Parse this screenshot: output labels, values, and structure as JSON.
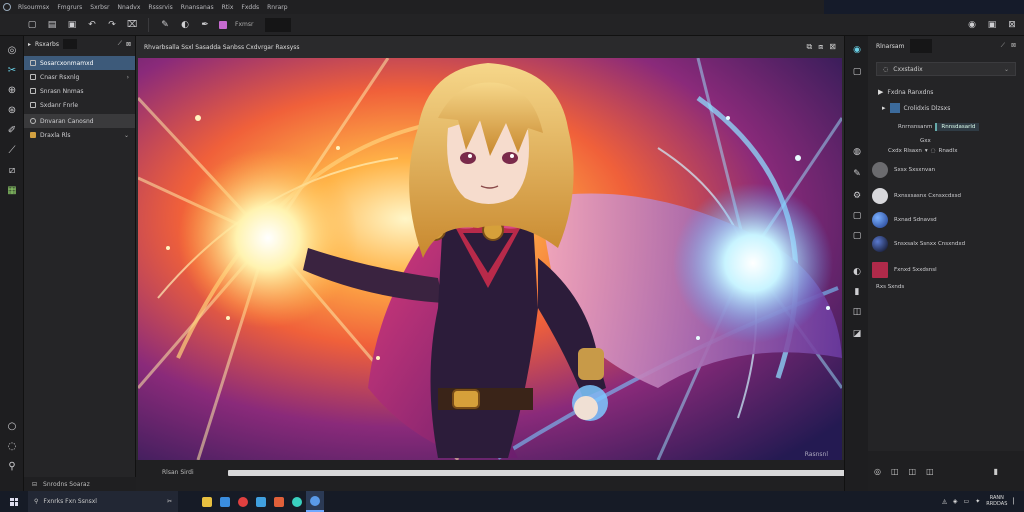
{
  "menubar": {
    "items": [
      "Rlsourmsx",
      "Fmgrurs",
      "Sxrbsr",
      "Nnadvx",
      "Rsssrvis",
      "Rnansanas",
      "Rtix",
      "Fxdds",
      "Rnrarp"
    ]
  },
  "toolbar": {
    "document_tab": "Fxmsr"
  },
  "layers": {
    "title": "Rsxarbs",
    "items": [
      {
        "label": "Sosarcxonmamxd"
      },
      {
        "label": "Cnasr Rsxnlg"
      },
      {
        "label": "Snrasn Nnmas"
      },
      {
        "label": "Sxdanr Fnrle"
      },
      {
        "label": "Dnvaran Canosnd"
      },
      {
        "label": "Draxla Rls"
      }
    ],
    "footer": "Snrodns Soaraz"
  },
  "document": {
    "title": "Rhvarbsalla Ssxl Sasadda Sanbss Cxdvrgar Raxsyss",
    "footer_tab": "Rlsan Sirdi",
    "watermark": "Rasnsnl"
  },
  "properties": {
    "title": "Rlnarsam",
    "select_value": "Cxxstadix",
    "tree_root": "Fxdna Ranxdns",
    "tree_child": "Crolidxis Dlzsxs",
    "prop1_label": "Rnrnsnsanm",
    "prop1_value": "Rnnsdasarld",
    "prop2_label": "Cxdx Rlsaxn",
    "prop2_value": "Rnadlx",
    "prop3_label": "Gxx",
    "swatches": [
      {
        "label": "Sxsx Sxsxnvan",
        "color": "#6b6b6e"
      },
      {
        "label": "Rxnsxsasnx Cxnsxcdxsd",
        "color": "#d8d8dc"
      },
      {
        "label": "Rxnad Sdnavsd",
        "color": "#1e3a8a"
      },
      {
        "label": "Snsxsalx Ssnxx Cnsxndxd",
        "color": "#0b0b1a"
      },
      {
        "label": "Fxnxd Sxxdsnsl",
        "color": "#b02a4a"
      }
    ],
    "extra": "Rxs Sxnds"
  },
  "taskbar": {
    "search_text": "Fxnrks Fxn Ssnsxl",
    "clock_time": "RANN",
    "clock_date": "RRDDAS"
  },
  "colors": {
    "accent": "#3d5a7a",
    "canvas_bg_warm": "#ff9a2e",
    "canvas_bg_cool": "#2a1a5e"
  }
}
